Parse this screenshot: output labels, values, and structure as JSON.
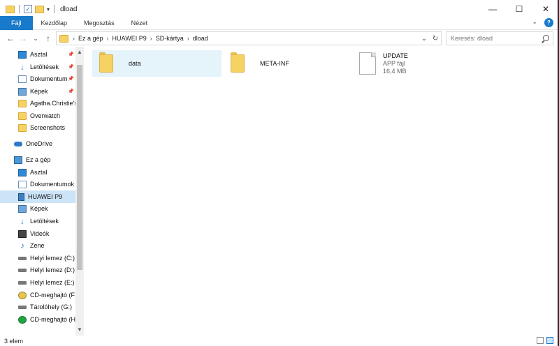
{
  "window": {
    "title": "dload",
    "minimize": "—",
    "maximize": "☐",
    "close": "✕"
  },
  "ribbon": {
    "tabs": [
      "Fájl",
      "Kezdőlap",
      "Megosztás",
      "Nézet"
    ],
    "expand": "⌄",
    "help": "?"
  },
  "nav": {
    "back": "←",
    "forward": "→",
    "recent": "⌄",
    "up": "↑",
    "breadcrumb": [
      "Ez a gép",
      "HUAWEI P9",
      "SD-kártya",
      "dload"
    ],
    "dropdown": "⌄",
    "refresh": "↻",
    "search_placeholder": "Keresés: dload"
  },
  "sidebar": {
    "items": [
      {
        "label": "Asztal",
        "icon": "desktop-icon",
        "pinned": "📌"
      },
      {
        "label": "Letöltések",
        "icon": "download-icon",
        "pinned": "📌"
      },
      {
        "label": "Dokumentum",
        "icon": "document-icon",
        "pinned": "📌"
      },
      {
        "label": "Képek",
        "icon": "pictures-icon",
        "pinned": "📌"
      },
      {
        "label": "Agatha.Christie's",
        "icon": "folder-icon"
      },
      {
        "label": "Overwatch",
        "icon": "folder-icon"
      },
      {
        "label": "Screenshots",
        "icon": "folder-icon"
      },
      {
        "label": "OneDrive",
        "icon": "cloud-icon"
      },
      {
        "label": "Ez a gép",
        "icon": "computer-icon"
      },
      {
        "label": "Asztal",
        "icon": "desktop-icon"
      },
      {
        "label": "Dokumentumok",
        "icon": "document-icon"
      },
      {
        "label": "HUAWEI P9",
        "icon": "phone-icon",
        "selected": true
      },
      {
        "label": "Képek",
        "icon": "pictures-icon"
      },
      {
        "label": "Letöltések",
        "icon": "download-icon"
      },
      {
        "label": "Videók",
        "icon": "video-icon"
      },
      {
        "label": "Zene",
        "icon": "music-icon"
      },
      {
        "label": "Helyi lemez (C:)",
        "icon": "drive-icon"
      },
      {
        "label": "Helyi lemez (D:)",
        "icon": "drive-icon"
      },
      {
        "label": "Helyi lemez (E:)",
        "icon": "drive-icon"
      },
      {
        "label": "CD-meghajtó (F:",
        "icon": "cd-icon"
      },
      {
        "label": "Tárolóhely (G:)",
        "icon": "drive-icon"
      },
      {
        "label": "CD-meghajtó (H",
        "icon": "cd-green-icon"
      }
    ]
  },
  "files": [
    {
      "name": "data",
      "type": "folder"
    },
    {
      "name": "META-INF",
      "type": "folder"
    },
    {
      "name": "UPDATE",
      "kind": "APP fájl",
      "size": "16,4 MB",
      "type": "file"
    }
  ],
  "status": {
    "count": "3 elem"
  }
}
